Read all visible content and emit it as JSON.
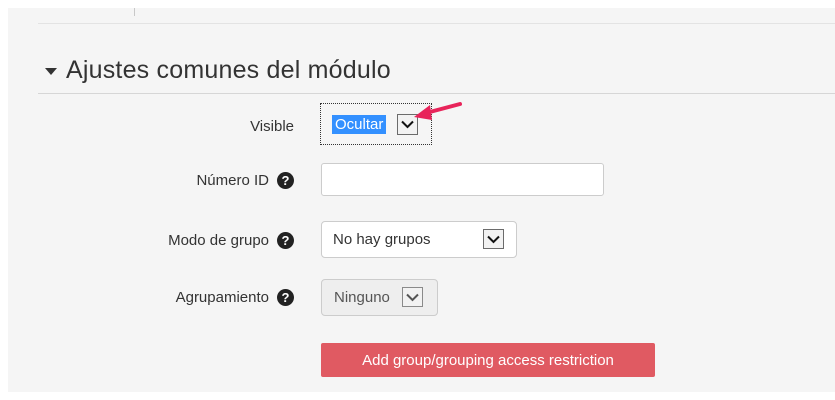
{
  "section": {
    "title": "Ajustes comunes del módulo"
  },
  "fields": {
    "visible": {
      "label": "Visible",
      "value": "Ocultar"
    },
    "id_number": {
      "label": "Número ID",
      "help_icon": "question-circle-icon",
      "value": ""
    },
    "group_mode": {
      "label": "Modo de grupo",
      "help_icon": "question-circle-icon",
      "value": "No hay grupos"
    },
    "grouping": {
      "label": "Agrupamiento",
      "help_icon": "question-circle-icon",
      "value": "Ninguno",
      "disabled": true
    }
  },
  "help_glyph": "?",
  "actions": {
    "add_restriction_label": "Add group/grouping access restriction"
  },
  "colors": {
    "panel_background": "#f5f5f5",
    "button_background": "#e05a62",
    "selection_highlight": "#3390ff",
    "annotation_arrow": "#e8245a"
  }
}
